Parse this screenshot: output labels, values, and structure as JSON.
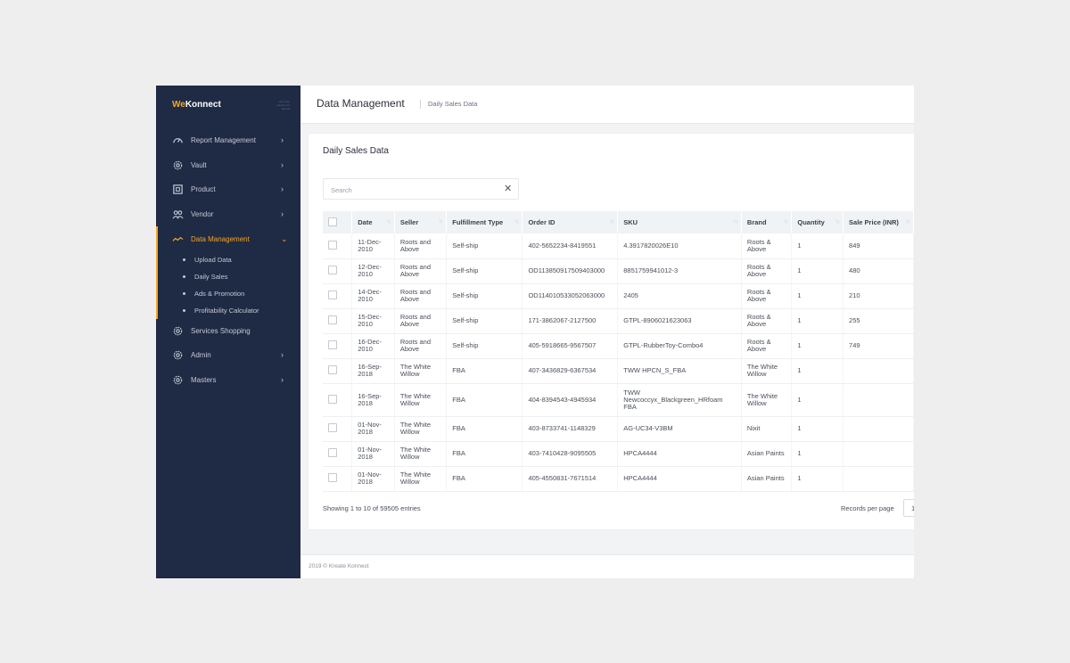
{
  "brand": {
    "we": "We",
    "konnect": "Konnect",
    "tagline": "One stop solution for brands"
  },
  "colors": {
    "accent": "#f5a623",
    "sidebar": "#1f2a44"
  },
  "sidebar": {
    "items": [
      {
        "label": "Report Management",
        "icon": "gauge-icon",
        "chevron": "›"
      },
      {
        "label": "Vault",
        "icon": "gear-icon",
        "chevron": "›"
      },
      {
        "label": "Product",
        "icon": "box-icon",
        "chevron": "›"
      },
      {
        "label": "Vendor",
        "icon": "users-icon",
        "chevron": "›"
      },
      {
        "label": "Data Management",
        "icon": "trend-icon",
        "chevron": "⌄"
      },
      {
        "label": "Services Shopping",
        "icon": "gear-icon",
        "chevron": ""
      },
      {
        "label": "Admin",
        "icon": "gear-icon",
        "chevron": "›"
      },
      {
        "label": "Masters",
        "icon": "gear-icon",
        "chevron": "›"
      }
    ],
    "subitems": [
      "Upload Data",
      "Daily Sales",
      "Ads & Promotion",
      "Profitability Calculator"
    ]
  },
  "header": {
    "title": "Data Management",
    "breadcrumb": "Daily Sales Data"
  },
  "card": {
    "title": "Daily Sales Data"
  },
  "search": {
    "placeholder": "Search",
    "clear": "✕"
  },
  "table": {
    "columns": [
      "Date",
      "Seller",
      "Fulfillment Type",
      "Order ID",
      "SKU",
      "Brand",
      "Quantity",
      "Sale Price (INR)"
    ],
    "rows": [
      [
        "11-Dec-2010",
        "Roots and Above",
        "Self-ship",
        "402-5652234-8419551",
        "4.3917820026E10",
        "Roots & Above",
        "1",
        "849"
      ],
      [
        "12-Dec-2010",
        "Roots and Above",
        "Self-ship",
        "OD113850917509403000",
        "8851759941012-3",
        "Roots & Above",
        "1",
        "480"
      ],
      [
        "14-Dec-2010",
        "Roots and Above",
        "Self-ship",
        "OD114010533052063000",
        "2405",
        "Roots & Above",
        "1",
        "210"
      ],
      [
        "15-Dec-2010",
        "Roots and Above",
        "Self-ship",
        "171-3862067-2127500",
        "GTPL-8906021623063",
        "Roots & Above",
        "1",
        "255"
      ],
      [
        "16-Dec-2010",
        "Roots and Above",
        "Self-ship",
        "405-5918665-9567507",
        "GTPL-RubberToy-Combo4",
        "Roots & Above",
        "1",
        "749"
      ],
      [
        "16-Sep-2018",
        "The White Willow",
        "FBA",
        "407-3436829-6367534",
        "TWW HPCN_S_FBA",
        "The White Willow",
        "1",
        ""
      ],
      [
        "16-Sep-2018",
        "The White Willow",
        "FBA",
        "404-8394543-4945934",
        "TWW Newcoccyx_Blackgreen_HRfoam FBA",
        "The White Willow",
        "1",
        ""
      ],
      [
        "01-Nov-2018",
        "The White Willow",
        "FBA",
        "403-8733741-1148329",
        "AG-UC34-V3BM",
        "Nixit",
        "1",
        ""
      ],
      [
        "01-Nov-2018",
        "The White Willow",
        "FBA",
        "403-7410428-9095505",
        "HPCA4444",
        "Asian Paints",
        "1",
        ""
      ],
      [
        "01-Nov-2018",
        "The White Willow",
        "FBA",
        "405-4550831-7671514",
        "HPCA4444",
        "Asian Paints",
        "1",
        ""
      ]
    ]
  },
  "pagination": {
    "showing": "Showing 1 to 10 of 59505 entries",
    "records_label": "Records per page",
    "records_value": "1"
  },
  "footer": {
    "copyright": "2019 © Kreate Konnect"
  }
}
